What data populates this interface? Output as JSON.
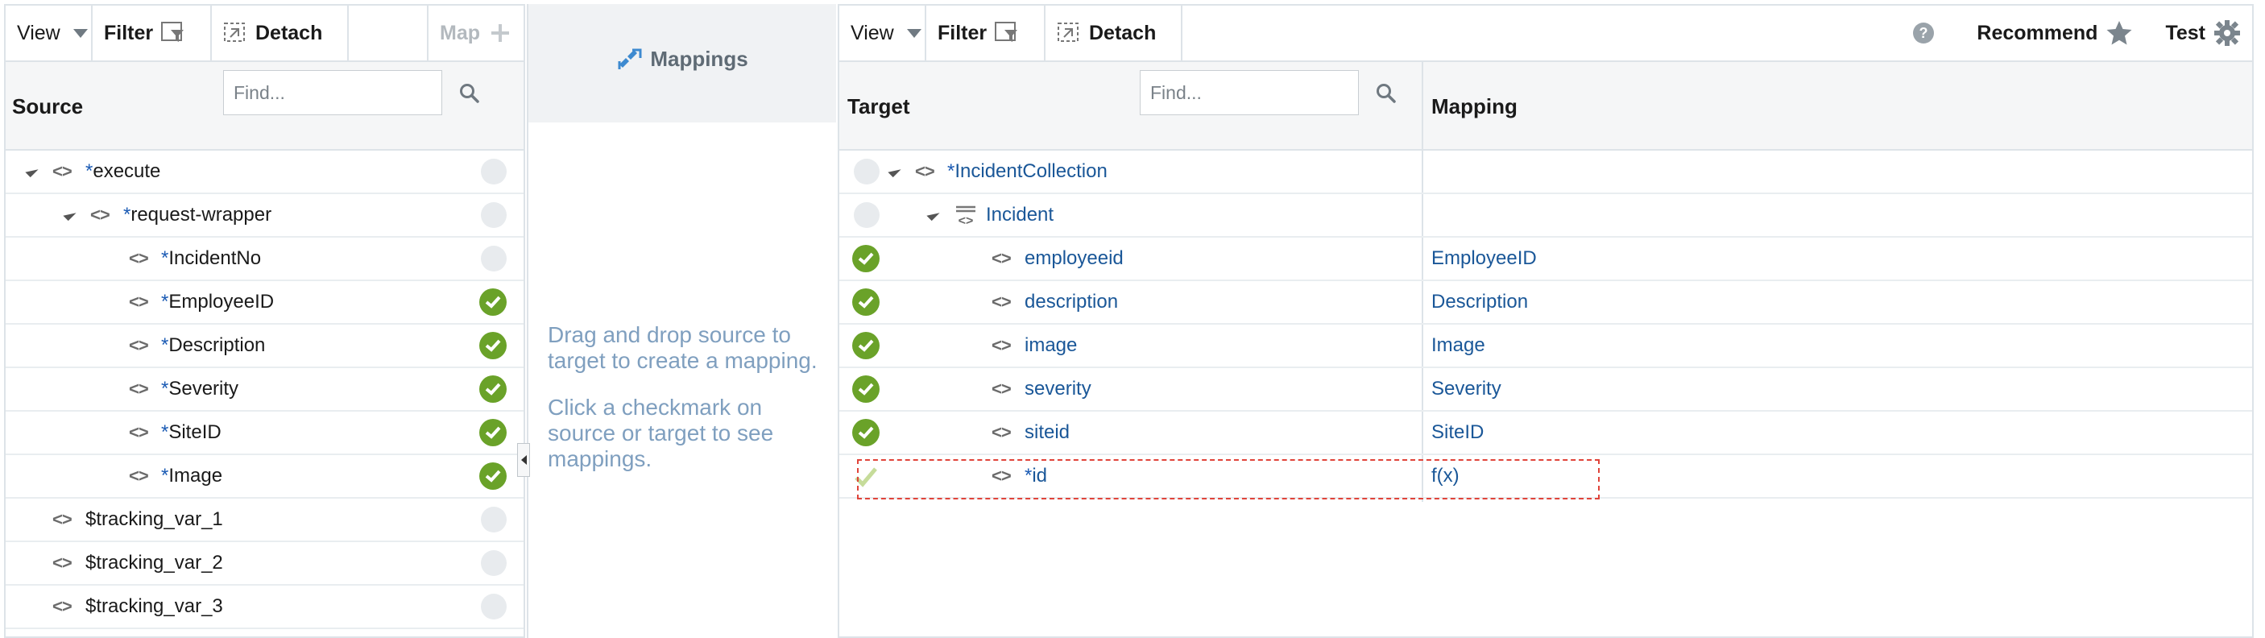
{
  "source_panel": {
    "toolbar": {
      "view_label": "View",
      "filter_label": "Filter",
      "detach_label": "Detach",
      "map_label": "Map"
    },
    "header": {
      "title": "Source",
      "find_placeholder": "Find..."
    },
    "rows": [
      {
        "name": "execute",
        "required": true,
        "indent": 0,
        "expanded": true,
        "mapped": false
      },
      {
        "name": "request-wrapper",
        "required": true,
        "indent": 1,
        "expanded": true,
        "mapped": false
      },
      {
        "name": "IncidentNo",
        "required": true,
        "indent": 2,
        "mapped": false
      },
      {
        "name": "EmployeeID",
        "required": true,
        "indent": 2,
        "mapped": true
      },
      {
        "name": "Description",
        "required": true,
        "indent": 2,
        "mapped": true
      },
      {
        "name": "Severity",
        "required": true,
        "indent": 2,
        "mapped": true
      },
      {
        "name": "SiteID",
        "required": true,
        "indent": 2,
        "mapped": true
      },
      {
        "name": "Image",
        "required": true,
        "indent": 2,
        "mapped": true
      },
      {
        "name": "$tracking_var_1",
        "required": false,
        "indent": 0,
        "mapped": false
      },
      {
        "name": "$tracking_var_2",
        "required": false,
        "indent": 0,
        "mapped": false
      },
      {
        "name": "$tracking_var_3",
        "required": false,
        "indent": 0,
        "mapped": false
      }
    ]
  },
  "mappings_panel": {
    "title": "Mappings",
    "hint_1": "Drag and drop source to target to create a mapping.",
    "hint_2": "Click a checkmark on source or target to see mappings."
  },
  "target_panel": {
    "toolbar": {
      "view_label": "View",
      "filter_label": "Filter",
      "detach_label": "Detach",
      "recommend_label": "Recommend",
      "test_label": "Test"
    },
    "header": {
      "target_title": "Target",
      "find_placeholder": "Find...",
      "mapping_title": "Mapping"
    },
    "rows": [
      {
        "name": "IncidentCollection",
        "required": true,
        "indent": 0,
        "expanded": true,
        "status": "none",
        "mapping": ""
      },
      {
        "name": "Incident",
        "required": false,
        "indent": 1,
        "expanded": true,
        "repeating": true,
        "status": "none",
        "mapping": ""
      },
      {
        "name": "employeeid",
        "required": false,
        "indent": 2,
        "status": "mapped",
        "mapping": "EmployeeID"
      },
      {
        "name": "description",
        "required": false,
        "indent": 2,
        "status": "mapped",
        "mapping": "Description"
      },
      {
        "name": "image",
        "required": false,
        "indent": 2,
        "status": "mapped",
        "mapping": "Image"
      },
      {
        "name": "severity",
        "required": false,
        "indent": 2,
        "status": "mapped",
        "mapping": "Severity"
      },
      {
        "name": "siteid",
        "required": false,
        "indent": 2,
        "status": "mapped",
        "mapping": "SiteID"
      },
      {
        "name": "id",
        "required": true,
        "indent": 2,
        "status": "function",
        "mapping": "f(x)"
      }
    ]
  },
  "colors": {
    "check_green": "#6aa229",
    "link_blue": "#1a5798",
    "hint_blue": "#7f9fbf",
    "error_dash": "#e0443a"
  }
}
